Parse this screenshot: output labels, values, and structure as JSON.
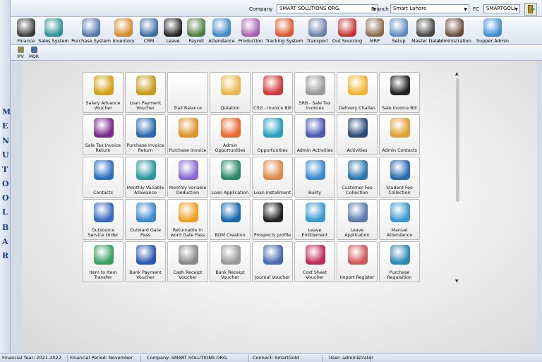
{
  "topbar": {
    "company_label": "Company",
    "company_value": "SMART SOLUTIONS ORG.",
    "branch_label": "Branch",
    "branch_value": "Smart Lahore",
    "fc_label": "FC",
    "fc_value": "SMARTGOLI"
  },
  "left_toolbar_letters": [
    "M",
    "E",
    "N",
    "U",
    "T",
    "O",
    "O",
    "L",
    "B",
    "A",
    "R"
  ],
  "menu": [
    {
      "label": "Finance",
      "icon": "finance-icon",
      "color": "#3a3a3a"
    },
    {
      "label": "Sales System",
      "icon": "sales-system-icon",
      "color": "#2c8f9a"
    },
    {
      "label": "Purchase System",
      "icon": "purchase-system-icon",
      "color": "#5577aa"
    },
    {
      "label": "Inventory",
      "icon": "inventory-icon",
      "color": "#d08a2a"
    },
    {
      "label": "CRM",
      "icon": "crm-icon",
      "color": "#3b6aa0"
    },
    {
      "label": "Leave",
      "icon": "leave-icon",
      "color": "#222222"
    },
    {
      "label": "Payroll",
      "icon": "payroll-icon",
      "color": "#4c7a3a"
    },
    {
      "label": "Attendance",
      "icon": "attendance-icon",
      "color": "#3e86c4"
    },
    {
      "label": "Production",
      "icon": "production-icon",
      "color": "#a25fb0"
    },
    {
      "label": "Tracking System",
      "icon": "tracking-icon",
      "color": "#d9572a"
    },
    {
      "label": "Transport",
      "icon": "transport-icon",
      "color": "#6a7fa3"
    },
    {
      "label": "Out Sourcing",
      "icon": "outsourcing-icon",
      "color": "#c23030"
    },
    {
      "label": "MRP",
      "icon": "mrp-icon",
      "color": "#8a6a4a"
    },
    {
      "label": "Setup",
      "icon": "setup-icon",
      "color": "#5a8ac0"
    },
    {
      "label": "Master Data",
      "icon": "master-data-icon",
      "color": "#444444"
    },
    {
      "label": "Administration",
      "icon": "administration-icon",
      "color": "#6a4a3a"
    },
    {
      "label": "Supper Admin",
      "icon": "super-admin-icon",
      "color": "#3a8ad0"
    }
  ],
  "submenu": [
    {
      "label": "IPV",
      "icon": "ipv-icon",
      "color": "#8a8a5a"
    },
    {
      "label": "MOR",
      "icon": "mor-icon",
      "color": "#4a6a9a"
    }
  ],
  "tiles": [
    {
      "label": "Salary Advance Voucher",
      "icon": "money-bag-icon",
      "color": "#d4a017"
    },
    {
      "label": "Loan Payment Voucher",
      "icon": "loan-money-bag-icon",
      "color": "#c99a1a"
    },
    {
      "label": "Trail Balance",
      "icon": "blank-icon",
      "color": "#f4f4f4"
    },
    {
      "label": "Qutation",
      "icon": "quotation-document-icon",
      "color": "#e8b84a"
    },
    {
      "label": "CSG - Invoice Bill",
      "icon": "sale-tag-icon",
      "color": "#d23a3a"
    },
    {
      "label": "SRB - Sale Tax Invoices",
      "icon": "receipt-icon",
      "color": "#9a9a9a"
    },
    {
      "label": "Delivery Challan",
      "icon": "sticky-note-icon",
      "color": "#f2b531"
    },
    {
      "label": "Sale Invoice Bill",
      "icon": "noodle-bowl-icon",
      "color": "#222222"
    },
    {
      "label": "Sale Tax Invoice Return",
      "icon": "tax-return-icon",
      "color": "#7a2a8a"
    },
    {
      "label": "Purchase Invoice Return",
      "icon": "return-arrow-icon",
      "color": "#2a6ab0"
    },
    {
      "label": "Purchase Invoice",
      "icon": "invoice-icon",
      "color": "#e0922a"
    },
    {
      "label": "Admin Opportunities",
      "icon": "admin-opportunity-icon",
      "color": "#e86a2a"
    },
    {
      "label": "Opportunities",
      "icon": "opportunity-arrows-icon",
      "color": "#2aa0c0"
    },
    {
      "label": "Admin Activities",
      "icon": "activity-list-icon",
      "color": "#4a5ab0"
    },
    {
      "label": "Activities",
      "icon": "activities-icon",
      "color": "#2a4a7a"
    },
    {
      "label": "Admin Contacts",
      "icon": "contact-book-icon",
      "color": "#e0a030"
    },
    {
      "label": "Contacts",
      "icon": "contact-card-icon",
      "color": "#2a70c0"
    },
    {
      "label": "Monthly Variable Allowance",
      "icon": "allowance-form-icon",
      "color": "#2a9aa0"
    },
    {
      "label": "Monthly Variable Deduction",
      "icon": "deduction-icon",
      "color": "#8a6ad0"
    },
    {
      "label": "Loan Application",
      "icon": "loan-application-icon",
      "color": "#2a8a6a"
    },
    {
      "label": "Loan Installment",
      "icon": "loan-document-icon",
      "color": "#e08a4a"
    },
    {
      "label": "Builty",
      "icon": "cargo-ship-icon",
      "color": "#3a8ad0"
    },
    {
      "label": "Customer Fee Collection",
      "icon": "fee-collection-icon",
      "color": "#2a7ab0"
    },
    {
      "label": "Student Fee Collection",
      "icon": "student-fee-icon",
      "color": "#2a6ab0"
    },
    {
      "label": "Outsource Service Order",
      "icon": "delivery-truck-icon",
      "color": "#3a6ac0"
    },
    {
      "label": "Returnable Outward Gate Pass",
      "icon": "gate-barrier-icon",
      "color": "#3a8ad0"
    },
    {
      "label": "Returnable In word Gate Pass",
      "icon": "magnet-icon",
      "color": "#f0a020"
    },
    {
      "label": "BOM Creation",
      "icon": "clipboard-icon",
      "color": "#1a6ab0"
    },
    {
      "label": "Prospects profile",
      "icon": "prospect-icon",
      "color": "#222222"
    },
    {
      "label": "Leave Entitlement",
      "icon": "pie-chart-icon",
      "color": "#3a9ad0"
    },
    {
      "label": "Leave Application",
      "icon": "application-form-icon",
      "color": "#5a7ab0"
    },
    {
      "label": "Manual Attendance",
      "icon": "manual-pie-icon",
      "color": "#3a9ad0"
    },
    {
      "label": "Item to Item Transfer",
      "icon": "transfer-icon",
      "color": "#3aa060"
    },
    {
      "label": "Bank Payment Voucher",
      "icon": "bank-card-icon",
      "color": "#2a5ab0"
    },
    {
      "label": "Cash Receipt Voucher",
      "icon": "cash-receipt-icon",
      "color": "#8a8a8a"
    },
    {
      "label": "Bank Receipt Voucher",
      "icon": "bank-receipt-icon",
      "color": "#9a9a9a"
    },
    {
      "label": "Journal Voucher",
      "icon": "journal-ticket-icon",
      "color": "#4a6ab0"
    },
    {
      "label": "Cost Sheet Voucher",
      "icon": "cost-sheet-icon",
      "color": "#c02a5a"
    },
    {
      "label": "Import Register",
      "icon": "import-ship-icon",
      "color": "#d05a5a"
    },
    {
      "label": "Purchase Requisition",
      "icon": "calculator-icon",
      "color": "#2a8ab0"
    }
  ],
  "statusbar": {
    "financial_year": "Financial Year: 2021-2022",
    "financial_period": "Financial Period: November",
    "company": "Company: SMART SOLUTIONS ORG.",
    "connect": "Connect: SmartGold",
    "user": "User: administrator"
  }
}
